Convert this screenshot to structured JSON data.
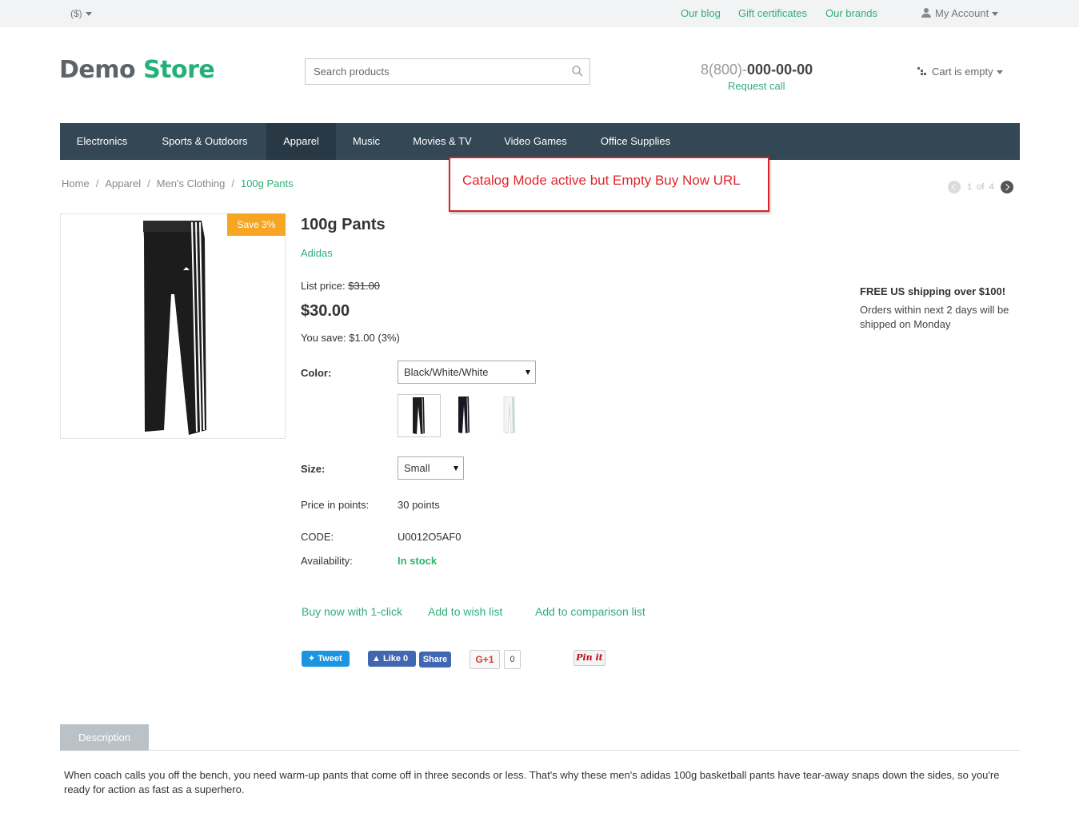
{
  "topbar": {
    "currency": "($)",
    "links": [
      "Our blog",
      "Gift certificates",
      "Our brands"
    ],
    "account": "My Account"
  },
  "header": {
    "logo_part1": "Demo",
    "logo_part2": "Store",
    "search_placeholder": "Search products",
    "phone_prefix": "8(800)-",
    "phone_number": "000-00-00",
    "request_call": "Request call",
    "cart": "Cart is empty"
  },
  "nav": {
    "items": [
      "Electronics",
      "Sports & Outdoors",
      "Apparel",
      "Music",
      "Movies & TV",
      "Video Games",
      "Office Supplies"
    ],
    "active": "Apparel"
  },
  "breadcrumb": [
    "Home",
    "Apparel",
    "Men's Clothing",
    "100g Pants"
  ],
  "annotation": "Catalog Mode active but Empty Buy Now URL",
  "pager": {
    "current": "1",
    "of": "of",
    "total": "4"
  },
  "product": {
    "badge": "Save 3%",
    "title": "100g Pants",
    "brand": "Adidas",
    "list_price_label": "List price:",
    "list_price": "$31.00",
    "price": "$30.00",
    "you_save": "You save: $1.00 (3%)",
    "color_label": "Color:",
    "color_value": "Black/White/White",
    "size_label": "Size:",
    "size_value": "Small",
    "points_label": "Price in points:",
    "points_value": "30 points",
    "code_label": "CODE:",
    "code_value": "U0012O5AF0",
    "availability_label": "Availability:",
    "availability_value": "In stock",
    "colors": {
      "in_stock": "#2fb46b",
      "accent": "#2fae7a",
      "badge": "#f6a623"
    }
  },
  "actions": {
    "buy_now": "Buy now with 1-click",
    "wishlist": "Add to wish list",
    "comparison": "Add to comparison list"
  },
  "social": {
    "tweet": "Tweet",
    "like": "Like 0",
    "share": "Share",
    "gplus": "G+1",
    "gplus_count": "0",
    "pin": "Pin it"
  },
  "shipping": {
    "title": "FREE US shipping over $100!",
    "text": "Orders within next 2 days will be shipped on Monday"
  },
  "tabs": {
    "description": "Description"
  },
  "description": "When coach calls you off the bench, you need warm-up pants that come off in three seconds or less. That's why these men's adidas 100g basketball pants have tear-away snaps down the sides, so you're ready for action as fast as a superhero."
}
